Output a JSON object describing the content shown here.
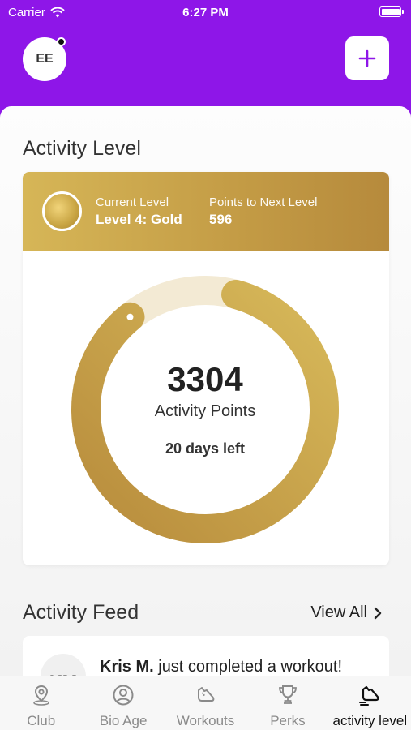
{
  "status": {
    "carrier": "Carrier",
    "time": "6:27 PM"
  },
  "header": {
    "avatar_initials": "EE",
    "add_label": "+"
  },
  "activity_level": {
    "title": "Activity Level",
    "current_level_label": "Current Level",
    "current_level_value": "Level 4: Gold",
    "points_next_label": "Points to Next Level",
    "points_next_value": "596",
    "points": "3304",
    "points_label": "Activity Points",
    "days_left": "20 days left",
    "progress_fraction": 0.85,
    "colors": {
      "gold_start": "#d7b95a",
      "gold_end": "#b88c3c",
      "track": "#f3ead4"
    }
  },
  "feed": {
    "title": "Activity Feed",
    "view_all": "View All",
    "items": [
      {
        "initials": "KM",
        "name": "Kris M.",
        "text": " just completed a workout!"
      }
    ]
  },
  "tabs": [
    {
      "label": "Club",
      "icon": "location-pin-icon"
    },
    {
      "label": "Bio Age",
      "icon": "person-circle-icon"
    },
    {
      "label": "Workouts",
      "icon": "running-shoe-icon"
    },
    {
      "label": "Perks",
      "icon": "trophy-icon"
    },
    {
      "label": "activity level",
      "icon": "activity-shoe-icon",
      "active": true
    }
  ],
  "colors": {
    "brand": "#8e16e8"
  }
}
